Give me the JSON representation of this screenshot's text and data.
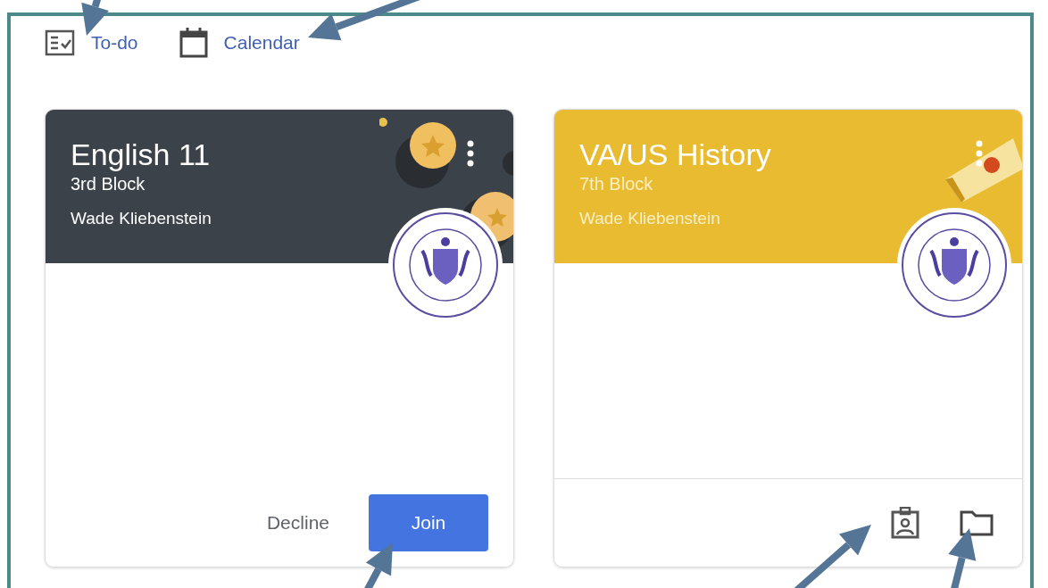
{
  "nav": [
    {
      "kind": "todo",
      "label": "To-do"
    },
    {
      "kind": "calendar",
      "label": "Calendar"
    }
  ],
  "classes": [
    {
      "title": "English 11",
      "section": "3rd Block",
      "teacher": "Wade Kliebenstein",
      "color": "#3c4249",
      "illustration": {
        "kind": "coins"
      },
      "kind": "invite",
      "actions": [
        {
          "kind": "text",
          "label": "Decline"
        },
        {
          "kind": "primary",
          "label": "Join"
        }
      ]
    },
    {
      "title": "VA/US History",
      "section": "7th Block",
      "teacher": "Wade Kliebenstein",
      "color": "#e8bb30",
      "illustration": {
        "kind": "flag"
      },
      "kind": "enrolled"
    }
  ]
}
